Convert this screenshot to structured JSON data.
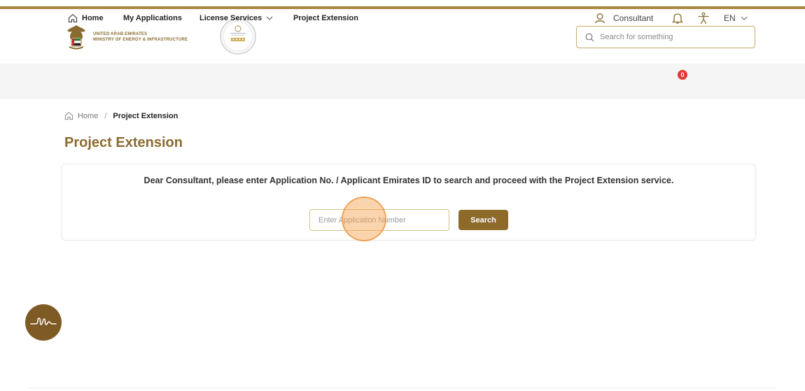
{
  "header": {
    "brand_line1": "UNITED ARAB EMIRATES",
    "brand_line2": "MINISTRY OF ENERGY & INFRASTRUCTURE",
    "search_placeholder": "Search for something"
  },
  "nav": {
    "home": "Home",
    "my_applications": "My Applications",
    "license_services": "License Services",
    "project_extension": "Project Extension",
    "user": "Consultant",
    "notifications_count": "0",
    "language": "EN"
  },
  "breadcrumb": {
    "home": "Home",
    "separator": "/",
    "current": "Project Extension"
  },
  "page": {
    "title": "Project Extension",
    "message": "Dear Consultant, please enter Application No. / Applicant Emirates ID to search and proceed with the Project Extension service.",
    "input_placeholder": "Enter Application Number",
    "search_button": "Search"
  },
  "colors": {
    "brand_gold": "#8a6b2f",
    "button_brown": "#8d6a2a",
    "nav_bg": "#f5f5f5",
    "badge_red": "#e53935"
  },
  "icons": [
    "uae-emblem-icon",
    "award-badge-icon",
    "search-icon",
    "home-icon",
    "chevron-down-icon",
    "user-icon",
    "bell-icon",
    "accessibility-icon",
    "chat-assistant-icon"
  ]
}
